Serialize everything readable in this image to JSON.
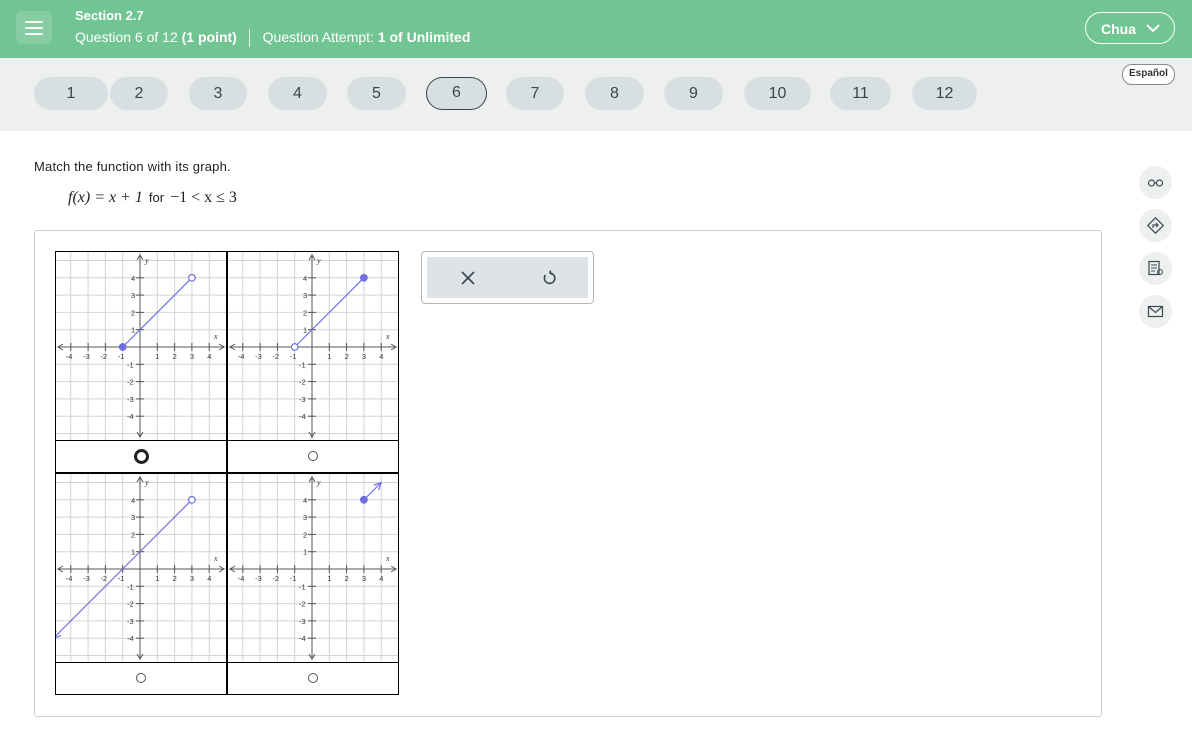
{
  "header": {
    "section": "Section 2.7",
    "question_prefix": "Question 6 of 12",
    "points": "(1 point)",
    "attempt_label": "Question Attempt:",
    "attempt_value": "1 of Unlimited",
    "user": "Chua",
    "bg_color": "#71c593"
  },
  "nav": {
    "questions": [
      "1",
      "2",
      "3",
      "4",
      "5",
      "6",
      "7",
      "8",
      "9",
      "10",
      "11",
      "12"
    ],
    "active": "6",
    "language": "Español"
  },
  "question": {
    "prompt": "Match the function with its graph.",
    "formula_lhs": "f(x) = x + 1",
    "formula_for": "for",
    "formula_domain": "−1 < x ≤ 3"
  },
  "tools": {
    "clear_icon": "close-icon",
    "undo_icon": "undo-icon"
  },
  "side_icons": [
    "glasses-icon",
    "directions-icon",
    "notes-icon",
    "mail-icon"
  ],
  "graphs": {
    "x_label": "x",
    "y_label": "y",
    "x_ticks": [
      "-4",
      "-3",
      "-2",
      "-1",
      "1",
      "2",
      "3",
      "4"
    ],
    "y_ticks": [
      "4",
      "3",
      "2",
      "1",
      "-1",
      "-2",
      "-3",
      "-4"
    ],
    "line_color": "#6f6fe0",
    "options": [
      {
        "id": "A",
        "selected": true,
        "segment": {
          "from": [
            -1,
            0
          ],
          "to": [
            3,
            4
          ],
          "from_closed": true,
          "to_closed": false,
          "arrow_start": false,
          "arrow_end": false
        }
      },
      {
        "id": "B",
        "selected": false,
        "segment": {
          "from": [
            -1,
            0
          ],
          "to": [
            3,
            4
          ],
          "from_closed": false,
          "to_closed": true,
          "arrow_start": false,
          "arrow_end": false
        }
      },
      {
        "id": "C",
        "selected": false,
        "segment": {
          "from": [
            -5,
            -4
          ],
          "to": [
            3,
            4
          ],
          "from_closed": false,
          "to_closed": false,
          "arrow_start": true,
          "arrow_end": false
        }
      },
      {
        "id": "D",
        "selected": false,
        "segment": {
          "from": [
            3,
            4
          ],
          "to": [
            4,
            5
          ],
          "from_closed": true,
          "to_closed": false,
          "arrow_start": false,
          "arrow_end": true
        }
      }
    ]
  }
}
